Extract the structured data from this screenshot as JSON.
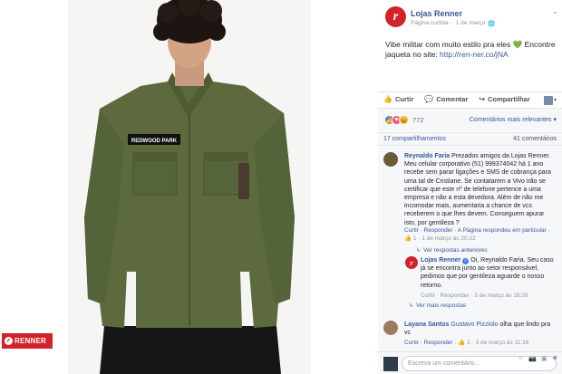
{
  "post": {
    "page_name": "Lojas Renner",
    "page_meta_label": "Página curtida",
    "page_meta_sep": "·",
    "page_meta_date": "1 de março",
    "page_meta_globe": "🌐",
    "chevron": "⌄",
    "caption_text": "Vibe militar com muito estilo pra eles 💚 Encontre jaqueta no site:",
    "caption_link": "http://ren-ner.co/jNA",
    "avatar_letter": "r"
  },
  "photo": {
    "brand_badge": "RENNER",
    "patch_text": "REDWOOD PARK"
  },
  "actions": {
    "like": "Curtir",
    "comment": "Comentar",
    "share": "Compartilhar"
  },
  "reactions": {
    "count": "772",
    "sort_label": "Comentários mais relevantes",
    "sort_arrow": "▾"
  },
  "stats": {
    "shares": "17 compartilhamentos",
    "comments": "41 comentários"
  },
  "comments": [
    {
      "name": "Reynaldo Faria",
      "text": "Prezados amigos da Lojas Renner. Meu celular corporativo (51) 999374042 há 1 ano recebe sem parar ligações e SMS de cobrança para uma tal de Cristiane. Se contatarem a Vivo irão se certificar que este nº de telefone pertence a uma empresa e não a esta devedora. Além de não me incomodar mais, aumentaria a chance de vcs receberem o que lhes devem. Conseguem apurar isto, por gentileza ?",
      "actions_line1": "Curtir · Responder · A Página respondeu em particular · ",
      "like_count": "1",
      "time": "· 1 de março às 20:22",
      "more_replies": "Ver respostas anteriores"
    },
    {
      "name": "Lojas Renner",
      "text": "Oi, Reynaldo Faria. Seu caso já se encontra junto ao setor responsável, pedimos que por gentileza aguarde o nosso retorno.",
      "actions": "Curtir · Responder · 3 de março às 16:28",
      "more_replies": "Ver mais respostas"
    },
    {
      "name": "Layana Santos",
      "mention": "Gustavo Pizziolo",
      "text": " olha que lindo pra vc",
      "actions": "Curtir · Responder · ",
      "like_count": "1",
      "time": "· 3 de março às 11:16"
    }
  ],
  "composer": {
    "placeholder": "Escreva um comentário..."
  }
}
